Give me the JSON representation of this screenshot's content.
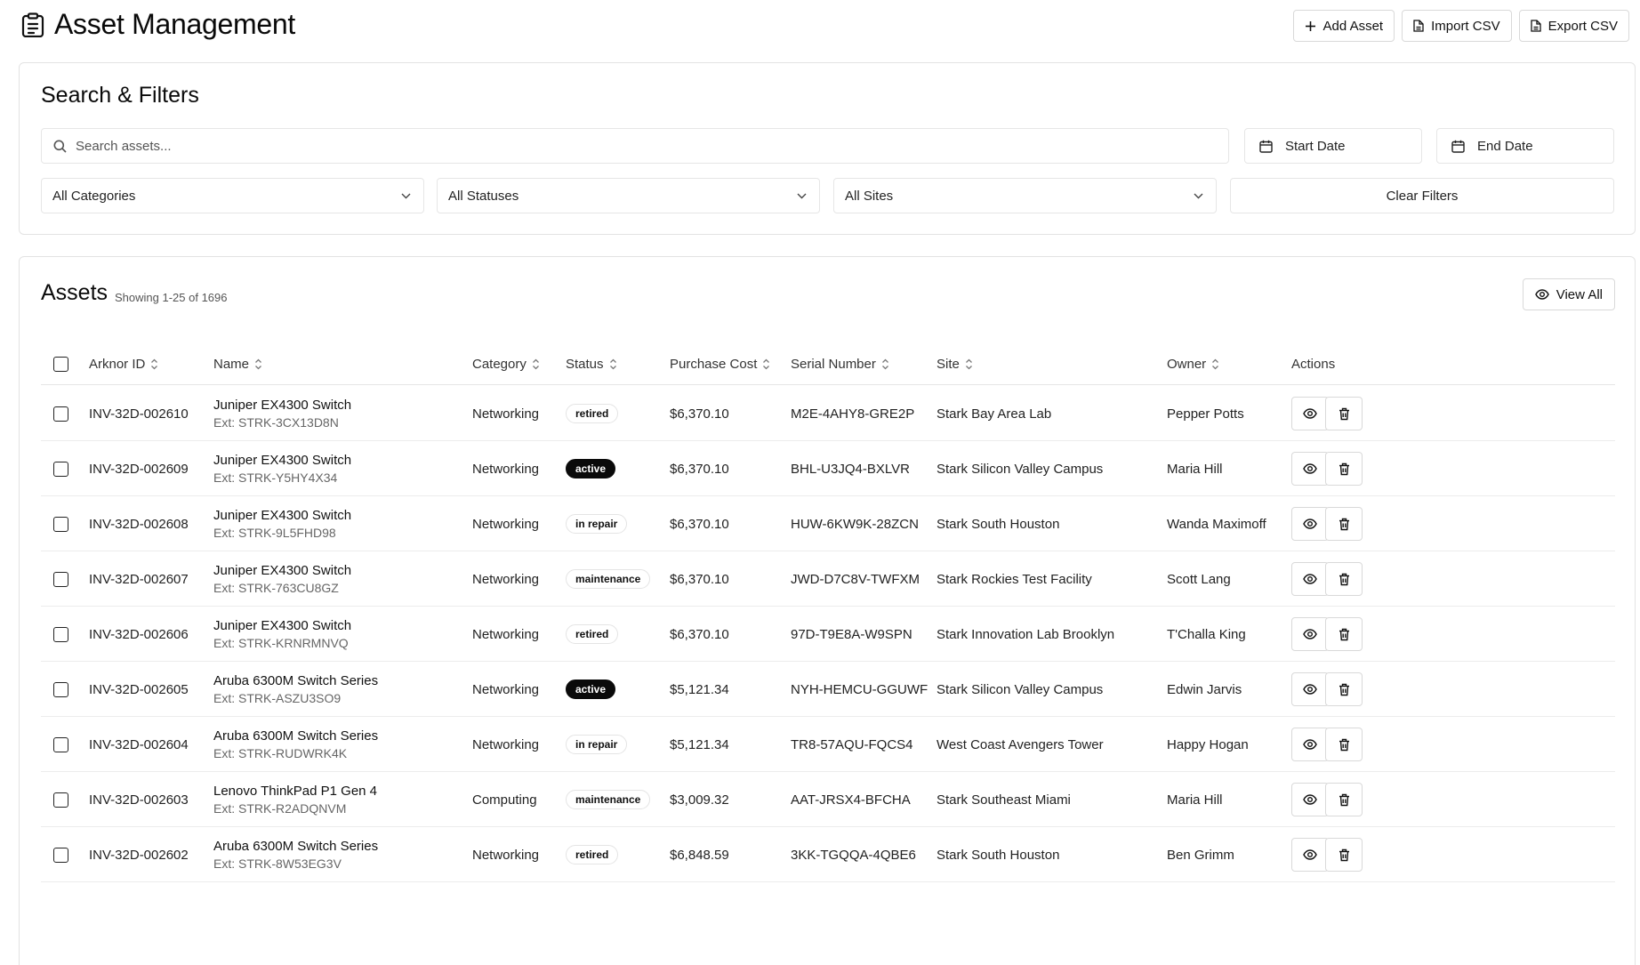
{
  "header": {
    "title": "Asset Management",
    "add_label": "Add Asset",
    "import_label": "Import CSV",
    "export_label": "Export CSV"
  },
  "filters": {
    "title": "Search & Filters",
    "search_placeholder": "Search assets...",
    "start_date": "Start Date",
    "end_date": "End Date",
    "category": "All Categories",
    "status": "All Statuses",
    "site": "All Sites",
    "clear_label": "Clear Filters"
  },
  "assets": {
    "title": "Assets",
    "count_text": "Showing 1-25 of 1696",
    "view_all_label": "View All",
    "columns": [
      "Arknor ID",
      "Name",
      "Category",
      "Status",
      "Purchase Cost",
      "Serial Number",
      "Site",
      "Owner",
      "Actions"
    ],
    "rows": [
      {
        "id": "INV-32D-002610",
        "name": "Juniper EX4300 Switch",
        "ext": "Ext: STRK-3CX13D8N",
        "category": "Networking",
        "status": "retired",
        "cost": "$6,370.10",
        "serial": "M2E-4AHY8-GRE2P",
        "site": "Stark Bay Area Lab",
        "owner": "Pepper Potts"
      },
      {
        "id": "INV-32D-002609",
        "name": "Juniper EX4300 Switch",
        "ext": "Ext: STRK-Y5HY4X34",
        "category": "Networking",
        "status": "active",
        "cost": "$6,370.10",
        "serial": "BHL-U3JQ4-BXLVR",
        "site": "Stark Silicon Valley Campus",
        "owner": "Maria Hill"
      },
      {
        "id": "INV-32D-002608",
        "name": "Juniper EX4300 Switch",
        "ext": "Ext: STRK-9L5FHD98",
        "category": "Networking",
        "status": "in repair",
        "cost": "$6,370.10",
        "serial": "HUW-6KW9K-28ZCN",
        "site": "Stark South Houston",
        "owner": "Wanda Maximoff"
      },
      {
        "id": "INV-32D-002607",
        "name": "Juniper EX4300 Switch",
        "ext": "Ext: STRK-763CU8GZ",
        "category": "Networking",
        "status": "maintenance",
        "cost": "$6,370.10",
        "serial": "JWD-D7C8V-TWFXM",
        "site": "Stark Rockies Test Facility",
        "owner": "Scott Lang"
      },
      {
        "id": "INV-32D-002606",
        "name": "Juniper EX4300 Switch",
        "ext": "Ext: STRK-KRNRMNVQ",
        "category": "Networking",
        "status": "retired",
        "cost": "$6,370.10",
        "serial": "97D-T9E8A-W9SPN",
        "site": "Stark Innovation Lab Brooklyn",
        "owner": "T'Challa King"
      },
      {
        "id": "INV-32D-002605",
        "name": "Aruba 6300M Switch Series",
        "ext": "Ext: STRK-ASZU3SO9",
        "category": "Networking",
        "status": "active",
        "cost": "$5,121.34",
        "serial": "NYH-HEMCU-GGUWF",
        "site": "Stark Silicon Valley Campus",
        "owner": "Edwin Jarvis"
      },
      {
        "id": "INV-32D-002604",
        "name": "Aruba 6300M Switch Series",
        "ext": "Ext: STRK-RUDWRK4K",
        "category": "Networking",
        "status": "in repair",
        "cost": "$5,121.34",
        "serial": "TR8-57AQU-FQCS4",
        "site": "West Coast Avengers Tower",
        "owner": "Happy Hogan"
      },
      {
        "id": "INV-32D-002603",
        "name": "Lenovo ThinkPad P1 Gen 4",
        "ext": "Ext: STRK-R2ADQNVM",
        "category": "Computing",
        "status": "maintenance",
        "cost": "$3,009.32",
        "serial": "AAT-JRSX4-BFCHA",
        "site": "Stark Southeast Miami",
        "owner": "Maria Hill"
      },
      {
        "id": "INV-32D-002602",
        "name": "Aruba 6300M Switch Series",
        "ext": "Ext: STRK-8W53EG3V",
        "category": "Networking",
        "status": "retired",
        "cost": "$6,848.59",
        "serial": "3KK-TGQQA-4QBE6",
        "site": "Stark South Houston",
        "owner": "Ben Grimm"
      }
    ]
  }
}
